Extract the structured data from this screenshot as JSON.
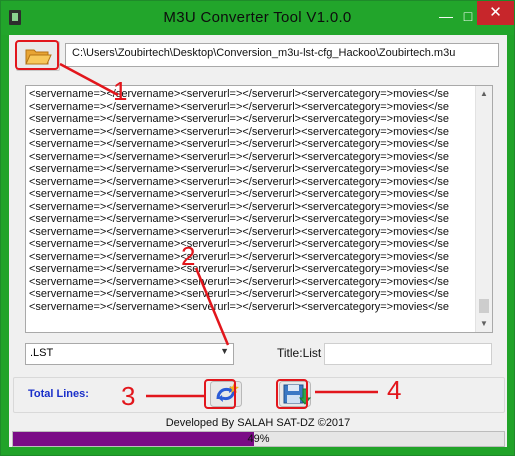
{
  "window": {
    "title": "M3U Converter Tool V1.0.0",
    "minimize_glyph": "—",
    "maximize_glyph": "□",
    "close_glyph": "✕"
  },
  "file": {
    "path": "C:\\Users\\Zoubirtech\\Desktop\\Conversion_m3u-lst-cfg_Hackoo\\Zoubirtech.m3u",
    "open_icon": "folder-open-icon"
  },
  "content": {
    "lines": [
      "<servername=></servername><serverurl=></serverurl><servercategory=>movies</se",
      "<servername=></servername><serverurl=></serverurl><servercategory=>movies</se",
      "<servername=></servername><serverurl=></serverurl><servercategory=>movies</se",
      "<servername=></servername><serverurl=></serverurl><servercategory=>movies</se",
      "<servername=></servername><serverurl=></serverurl><servercategory=>movies</se",
      "<servername=></servername><serverurl=></serverurl><servercategory=>movies</se",
      "<servername=></servername><serverurl=></serverurl><servercategory=>movies</se",
      "<servername=></servername><serverurl=></serverurl><servercategory=>movies</se",
      "<servername=></servername><serverurl=></serverurl><servercategory=>movies</se",
      "<servername=></servername><serverurl=></serverurl><servercategory=>movies</se",
      "<servername=></servername><serverurl=></serverurl><servercategory=>movies</se",
      "<servername=></servername><serverurl=></serverurl><servercategory=>movies</se",
      "<servername=></servername><serverurl=></serverurl><servercategory=>movies</se",
      "<servername=></servername><serverurl=></serverurl><servercategory=>movies</se",
      "<servername=></servername><serverurl=></serverurl><servercategory=>movies</se",
      "<servername=></servername><serverurl=></serverurl><servercategory=>movies</se",
      "<servername=></servername><serverurl=></serverurl><servercategory=>movies</se",
      "<servername=></servername><serverurl=></serverurl><servercategory=>movies</se"
    ]
  },
  "format": {
    "selected": ".LST"
  },
  "title_field": {
    "label": "Title:",
    "value": "List"
  },
  "totals": {
    "label": "Total Lines:"
  },
  "footer": {
    "developer": "Developed By SALAH SAT-DZ ©2017"
  },
  "progress": {
    "percent": 49,
    "text": "49%"
  },
  "annotations": {
    "labels": [
      "1",
      "2",
      "3",
      "4"
    ],
    "color": "#e2161c"
  },
  "colors": {
    "titlebar": "#22a52b",
    "close": "#c7262b",
    "progress_fill": "#7a0c86",
    "total_label": "#1a2fc9"
  }
}
